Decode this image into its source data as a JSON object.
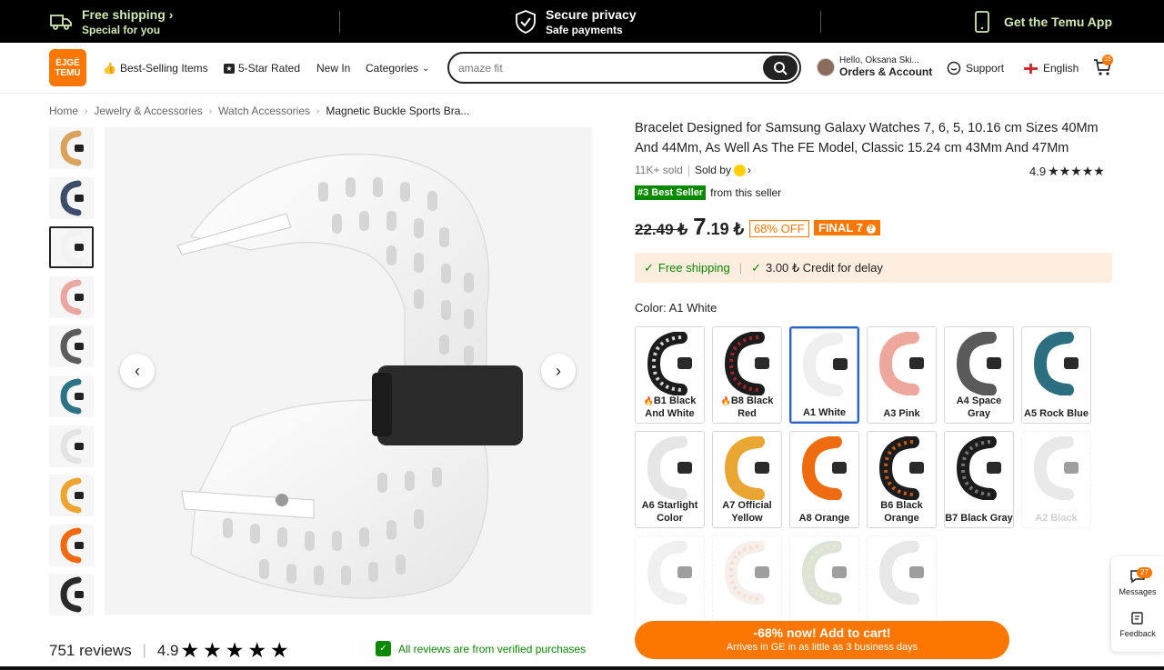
{
  "promo": {
    "shipping_title": "Free shipping",
    "shipping_sub": "Special for you",
    "privacy_title": "Secure privacy",
    "privacy_sub": "Safe payments",
    "app_label": "Get the Temu App"
  },
  "header": {
    "logo_text_top": "ÈJGÈ",
    "logo_text_bottom": "TEMU",
    "nav": [
      "Best-Selling Items",
      "5-Star Rated",
      "New In",
      "Categories"
    ],
    "search_placeholder": "amaze fit",
    "account_greeting": "Hello, Oksana Ski...",
    "account_label": "Orders & Account",
    "support_label": "Support",
    "language_label": "English",
    "cart_count": "15"
  },
  "breadcrumb": [
    "Home",
    "Jewelry & Accessories",
    "Watch Accessories",
    "Magnetic Buckle Sports Bra..."
  ],
  "gallery": {
    "thumb_colors": [
      "#d9a35c",
      "#3d4d6b",
      "#f2f2f2",
      "#e9a7a0",
      "#5c5c5c",
      "#2b7385",
      "#e4e4e4",
      "#eea52f",
      "#ef6a12",
      "#2a2a2a"
    ],
    "selected_index": 2
  },
  "reviews": {
    "count": "751 reviews",
    "score": "4.9",
    "stars": "★★★★★",
    "verified_text": "All reviews are from verified purchases"
  },
  "product": {
    "title": "Bracelet Designed for Samsung Galaxy Watches 7, 6, 5, 10.16 cm Sizes 40Mm And 44Mm, As Well As The FE Model, Classic 15.24 cm 43Mm And 47Mm",
    "sold": "11K+ sold",
    "sold_by": "Sold by",
    "rating": "4.9",
    "rating_stars": "★★★★★",
    "best_seller_tag": "#3 Best Seller",
    "best_seller_suffix": "from this seller",
    "old_price": "22.49 ₺",
    "new_price_big": "7",
    "new_price_small": ".19 ₺",
    "off_badge": "68% OFF",
    "final_badge": "FINAL 7",
    "shipping_label": "Free shipping",
    "credit_label": "3.00 ₺ Credit for delay",
    "color_prefix": "Color:",
    "color_value": "A1 White"
  },
  "swatches": [
    {
      "label": "B1 Black And White",
      "color": "#1c1c1c",
      "accent": "#ffffff",
      "selected": false,
      "disabled": false,
      "hot": true
    },
    {
      "label": "B8 Black Red",
      "color": "#1c1c1c",
      "accent": "#c2252b",
      "selected": false,
      "disabled": false,
      "hot": true
    },
    {
      "label": "A1 White",
      "color": "#efefef",
      "accent": "#efefef",
      "selected": true,
      "disabled": false,
      "hot": false
    },
    {
      "label": "A3 Pink",
      "color": "#eda79d",
      "accent": "#eda79d",
      "selected": false,
      "disabled": false,
      "hot": false
    },
    {
      "label": "A4 Space Gray",
      "color": "#5a5a5a",
      "accent": "#5a5a5a",
      "selected": false,
      "disabled": false,
      "hot": false
    },
    {
      "label": "A5 Rock Blue",
      "color": "#2b6f80",
      "accent": "#2b6f80",
      "selected": false,
      "disabled": false,
      "hot": false
    },
    {
      "label": "A6 Starlight Color",
      "color": "#e6e6e6",
      "accent": "#e6e6e6",
      "selected": false,
      "disabled": false,
      "hot": false
    },
    {
      "label": "A7 Official Yellow",
      "color": "#eaa633",
      "accent": "#eaa633",
      "selected": false,
      "disabled": false,
      "hot": false
    },
    {
      "label": "A8 Orange",
      "color": "#ef6b10",
      "accent": "#ef6b10",
      "selected": false,
      "disabled": false,
      "hot": false
    },
    {
      "label": "B6 Black Orange",
      "color": "#1c1c1c",
      "accent": "#ef6b10",
      "selected": false,
      "disabled": false,
      "hot": false
    },
    {
      "label": "B7 Black Gray",
      "color": "#1c1c1c",
      "accent": "#8a8a8a",
      "selected": false,
      "disabled": false,
      "hot": false
    },
    {
      "label": "A2 Black",
      "color": "#cfcfcf",
      "accent": "#cfcfcf",
      "selected": false,
      "disabled": true,
      "hot": false
    },
    {
      "label": "",
      "color": "#e0e0e0",
      "accent": "#e0e0e0",
      "selected": false,
      "disabled": true,
      "hot": false
    },
    {
      "label": "",
      "color": "#eddcd6",
      "accent": "#f2a784",
      "selected": false,
      "disabled": true,
      "hot": false
    },
    {
      "label": "",
      "color": "#b6c4a8",
      "accent": "#c9d77a",
      "selected": false,
      "disabled": true,
      "hot": false
    },
    {
      "label": "",
      "color": "#cdcdcd",
      "accent": "#cdcdcd",
      "selected": false,
      "disabled": true,
      "hot": false
    }
  ],
  "cta": {
    "main": "-68% now! Add to cart!",
    "sub": "Arrives in GE in as little as 3 business days"
  },
  "side": {
    "messages_label": "Messages",
    "messages_count": "27",
    "feedback_label": "Feedback"
  },
  "colors": {
    "brand": "#fb7701",
    "green": "#0a8a00",
    "selected_border": "#2a62c9"
  }
}
